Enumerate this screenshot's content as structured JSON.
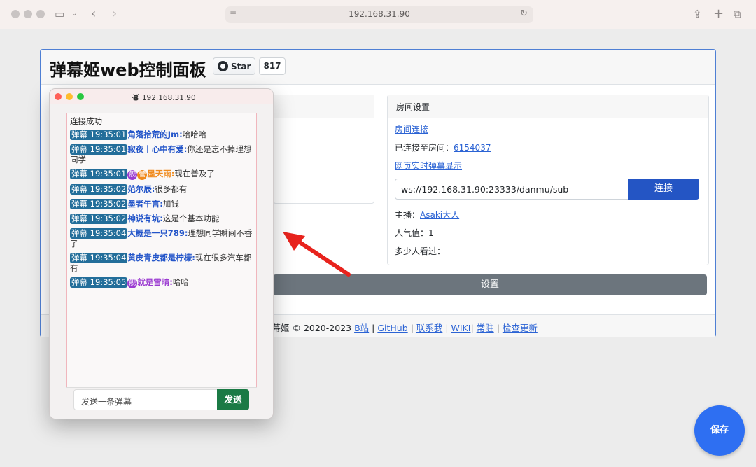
{
  "browser": {
    "url": "192.168.31.90"
  },
  "main": {
    "title": "弹幕姬web控制面板",
    "github": {
      "star_label": "Star",
      "star_count": "817"
    },
    "room": {
      "header": "房间设置",
      "room_connect_link": "房间连接",
      "connected_label": "已连接至房间：",
      "room_id": "6154037",
      "web_display_link": "网页实时弹幕显示",
      "ws_url": "ws://192.168.31.90:23333/danmu/sub",
      "connect_button": "连接",
      "host_label": "主播：",
      "host_name": "Asaki大人",
      "popularity_label": "人气值：",
      "popularity_value": "1",
      "viewers_label": "多少人看过："
    },
    "settings_button": "设置",
    "footer": {
      "prefix": "弹幕姬 © 2020-2023",
      "links": [
        "B站",
        "GitHub",
        "联系我",
        "WIKI",
        "常驻",
        "检查更新"
      ]
    },
    "save_button": "保存"
  },
  "danmu_window": {
    "title": "192.168.31.90",
    "status": "连接成功",
    "messages": [
      {
        "tag": "弹幕 19:35:01",
        "badges": [],
        "user": "角落拾荒的Jm:",
        "text": "哈哈哈",
        "user_color": "blue"
      },
      {
        "tag": "弹幕 19:35:01",
        "badges": [],
        "user": "寂夜丨心中有爱:",
        "text": "你还是忘不掉理想同学",
        "user_color": "blue"
      },
      {
        "tag": "弹幕 19:35:01",
        "badges": [
          "舰",
          "管"
        ],
        "user": "墨天雨:",
        "text": "现在普及了",
        "user_color": "orange"
      },
      {
        "tag": "弹幕 19:35:02",
        "badges": [],
        "user": "范尔辰:",
        "text": "很多都有",
        "user_color": "blue"
      },
      {
        "tag": "弹幕 19:35:02",
        "badges": [],
        "user": "墨者午言:",
        "text": "加钱",
        "user_color": "blue"
      },
      {
        "tag": "弹幕 19:35:02",
        "badges": [],
        "user": "神说有坑:",
        "text": "这是个基本功能",
        "user_color": "blue"
      },
      {
        "tag": "弹幕 19:35:04",
        "badges": [],
        "user": "大概是一只789:",
        "text": "理想同学瞬间不香了",
        "user_color": "blue"
      },
      {
        "tag": "弹幕 19:35:04",
        "badges": [],
        "user": "黄皮青皮都是柠檬:",
        "text": "现在很多汽车都有",
        "user_color": "blue"
      },
      {
        "tag": "弹幕 19:35:05",
        "badges": [
          "舰"
        ],
        "user": "就是雪晴:",
        "text": "哈哈",
        "user_color": "purple"
      }
    ],
    "send_placeholder": "发送一条弹幕",
    "send_button": "发送"
  },
  "colors": {
    "accent": "#2455c4",
    "tag_bg": "#236e9a",
    "send_green": "#1b7a45",
    "arrow_red": "#e8231d"
  }
}
